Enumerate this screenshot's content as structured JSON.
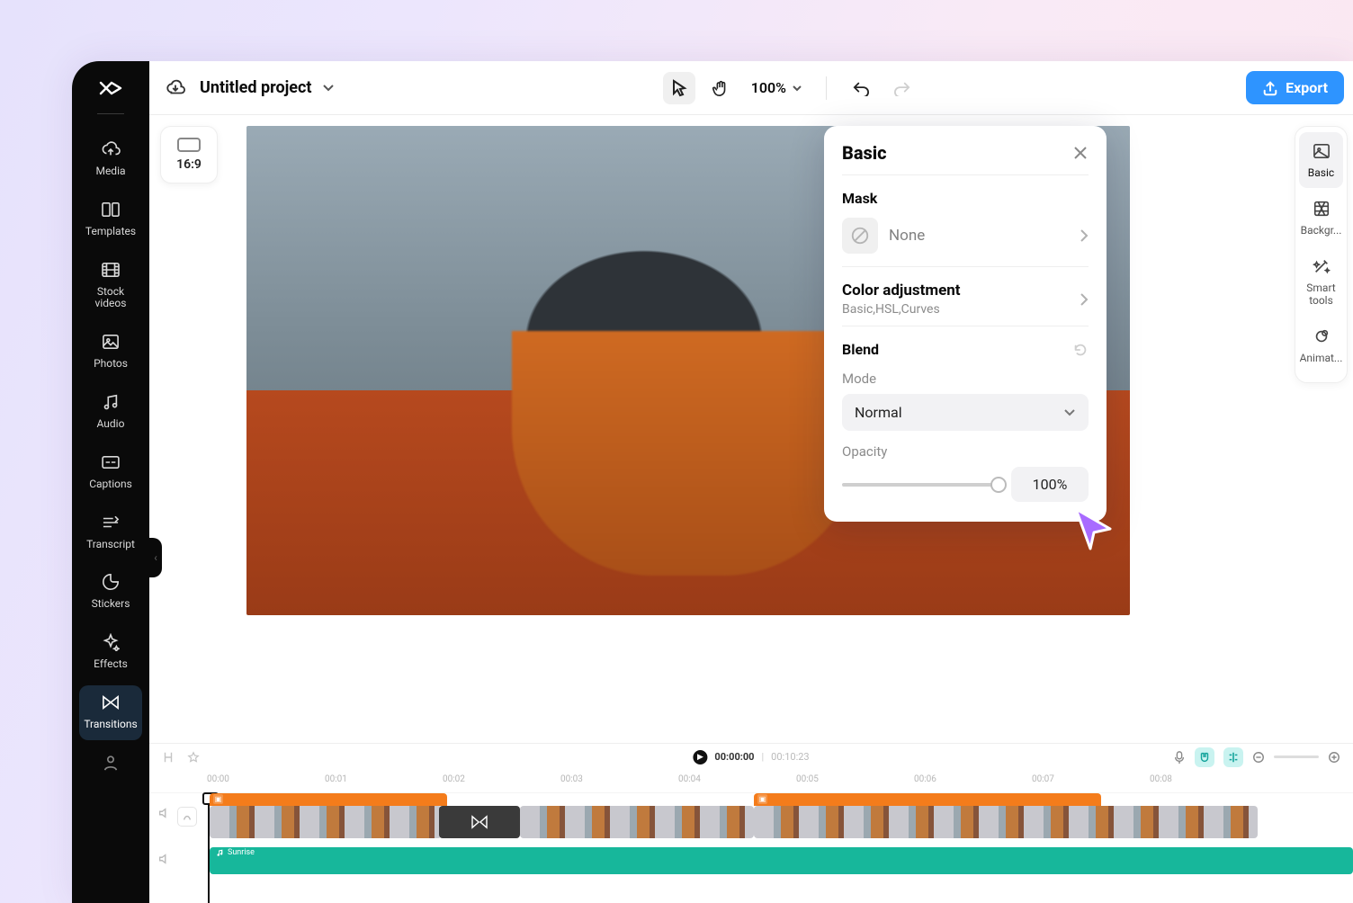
{
  "project": {
    "title": "Untitled project"
  },
  "topbar": {
    "zoom": "100%",
    "export_label": "Export"
  },
  "left_nav": {
    "items": [
      {
        "label": "Media"
      },
      {
        "label": "Templates"
      },
      {
        "label": "Stock videos"
      },
      {
        "label": "Photos"
      },
      {
        "label": "Audio"
      },
      {
        "label": "Captions"
      },
      {
        "label": "Transcript"
      },
      {
        "label": "Stickers"
      },
      {
        "label": "Effects"
      },
      {
        "label": "Transitions"
      }
    ],
    "active_index": 9
  },
  "aspect_ratio_chip": {
    "label": "16:9"
  },
  "props": {
    "title": "Basic",
    "mask": {
      "section": "Mask",
      "value": "None"
    },
    "color_adjustment": {
      "title": "Color adjustment",
      "subtitle": "Basic,HSL,Curves"
    },
    "blend": {
      "section": "Blend",
      "mode_label": "Mode",
      "mode_value": "Normal",
      "opacity_label": "Opacity",
      "opacity_value": "100%"
    }
  },
  "right_tabs": {
    "items": [
      {
        "label": "Basic"
      },
      {
        "label": "Backgr..."
      },
      {
        "label": "Smart tools"
      },
      {
        "label": "Animat..."
      }
    ],
    "active_index": 0
  },
  "timeline": {
    "current_time": "00:00:00",
    "duration": "00:10:23",
    "ruler_ticks": [
      "00:00",
      "00:01",
      "00:02",
      "00:03",
      "00:04",
      "00:05",
      "00:06",
      "00:07",
      "00:08"
    ],
    "audio_clip_label": "Sunrise"
  }
}
